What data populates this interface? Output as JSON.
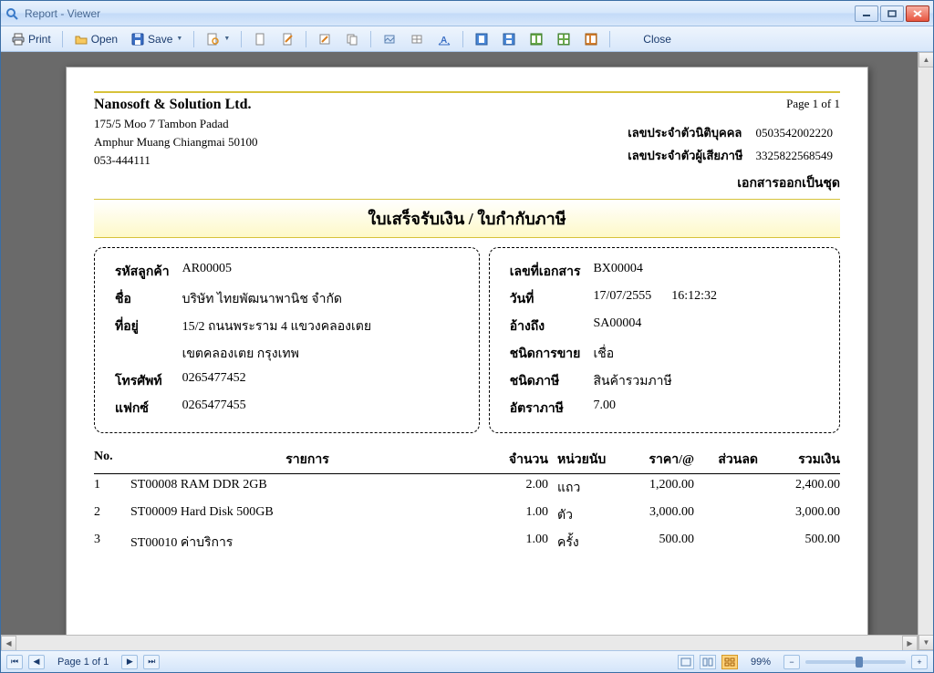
{
  "window": {
    "title": "Report - Viewer"
  },
  "toolbar": {
    "print": "Print",
    "open": "Open",
    "save": "Save",
    "close": "Close"
  },
  "report": {
    "page_of": "Page 1 of 1",
    "company_name": "Nanosoft & Solution Ltd.",
    "address1": "175/5 Moo 7 Tambon Padad",
    "address2": "Amphur Muang Chiangmai 50100",
    "phone": "053-444111",
    "corp_id_label": "เลขประจำตัวนิติบุคคล",
    "corp_id": "0503542002220",
    "tax_id_label": "เลขประจำตัวผู้เสียภาษี",
    "tax_id": "3325822568549",
    "doc_note": "เอกสารออกเป็นชุด",
    "doc_title": "ใบเสร็จรับเงิน / ใบกำกับภาษี",
    "customer": {
      "code_label": "รหัสลูกค้า",
      "code": "AR00005",
      "name_label": "ชื่อ",
      "name": "บริษัท ไทยพัฒนาพานิช จำกัด",
      "addr_label": "ที่อยู่",
      "addr1": "15/2 ถนนพระราม 4 แขวงคลองเตย",
      "addr2": "เขตคลองเตย กรุงเทพ",
      "tel_label": "โทรศัพท์",
      "tel": "0265477452",
      "fax_label": "แฟกซ์",
      "fax": "0265477455"
    },
    "doc": {
      "no_label": "เลขที่เอกสาร",
      "no": "BX00004",
      "date_label": "วันที่",
      "date": "17/07/2555",
      "time": "16:12:32",
      "ref_label": "อ้างถึง",
      "ref": "SA00004",
      "sale_type_label": "ชนิดการขาย",
      "sale_type": "เชื่อ",
      "vat_type_label": "ชนิดภาษี",
      "vat_type": "สินค้ารวมภาษี",
      "vat_rate_label": "อัตราภาษี",
      "vat_rate": "7.00"
    },
    "columns": {
      "no": "No.",
      "desc": "รายการ",
      "qty": "จำนวน",
      "unit": "หน่วยนับ",
      "price": "ราคา/@",
      "disc": "ส่วนลด",
      "total": "รวมเงิน"
    },
    "items": [
      {
        "no": "1",
        "desc": "ST00008 RAM DDR 2GB",
        "qty": "2.00",
        "unit": "แถว",
        "price": "1,200.00",
        "disc": "",
        "total": "2,400.00"
      },
      {
        "no": "2",
        "desc": "ST00009 Hard Disk 500GB",
        "qty": "1.00",
        "unit": "ตัว",
        "price": "3,000.00",
        "disc": "",
        "total": "3,000.00"
      },
      {
        "no": "3",
        "desc": "ST00010 ค่าบริการ",
        "qty": "1.00",
        "unit": "ครั้ง",
        "price": "500.00",
        "disc": "",
        "total": "500.00"
      }
    ]
  },
  "status": {
    "page_of": "Page 1 of 1",
    "zoom": "99%"
  }
}
